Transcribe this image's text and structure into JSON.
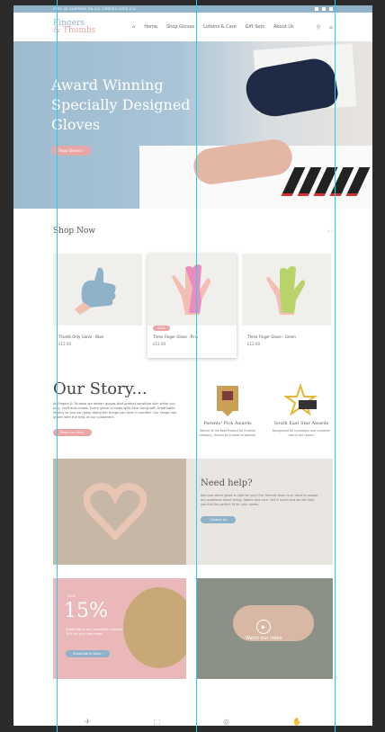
{
  "topbar": {
    "promo": "FREE UK SHIPPING ON ALL ORDERS OVER £30"
  },
  "logo": {
    "line1": "Fingers",
    "line2": "& Thumbs"
  },
  "nav": [
    "Home",
    "Shop Gloves",
    "Lotions & Care",
    "Gift Sets",
    "About Us"
  ],
  "hero": {
    "title": "Award Winning Specially Designed Gloves",
    "cta": "Shop Gloves ›"
  },
  "shop": {
    "title": "Shop Now",
    "arrows": "‹  ›",
    "products": [
      {
        "name": "Thumb Only Glove - Blue",
        "price": "£12.00",
        "color": "#8fb2c8",
        "badge": ""
      },
      {
        "name": "Three Finger Glove - Pink",
        "price": "£12.00",
        "color": "#e98cc0",
        "badge": "SALE"
      },
      {
        "name": "Three Finger Glove - Green",
        "price": "£12.00",
        "color": "#b7d36a",
        "badge": ""
      }
    ]
  },
  "story": {
    "title": "Our Story...",
    "text": "At Fingers & Thumbs we design gloves that protect sensitive skin while you play, craft and create. Every glove is made with care using soft, breathable fabrics so you can keep doing the things you love in comfort. Our range has grown with the help of our customers.",
    "cta": "Read Our Story"
  },
  "awards": [
    {
      "title": "Parents' Pick Awards",
      "text": "Winner of the Best Product for Eczema category, chosen by a panel of parents."
    },
    {
      "title": "South East Star Awards",
      "text": "Recognised for innovation and customer care in our region."
    }
  ],
  "help": {
    "title": "Need help?",
    "text": "Not sure which glove is right for you? Our friendly team is on hand to answer any questions about sizing, fabrics and care. Get in touch and we will help you find the perfect fit for your needs.",
    "cta": "Contact Us"
  },
  "promo": {
    "off": "SAVE",
    "pct": "15%",
    "small": "Subscribe to our newsletter and get 15% off your first order",
    "cta": "Subscribe & Save ›"
  },
  "video": {
    "label": "Watch our video"
  },
  "footer_icons": [
    "✈",
    "⬚",
    "◎",
    "✋"
  ]
}
